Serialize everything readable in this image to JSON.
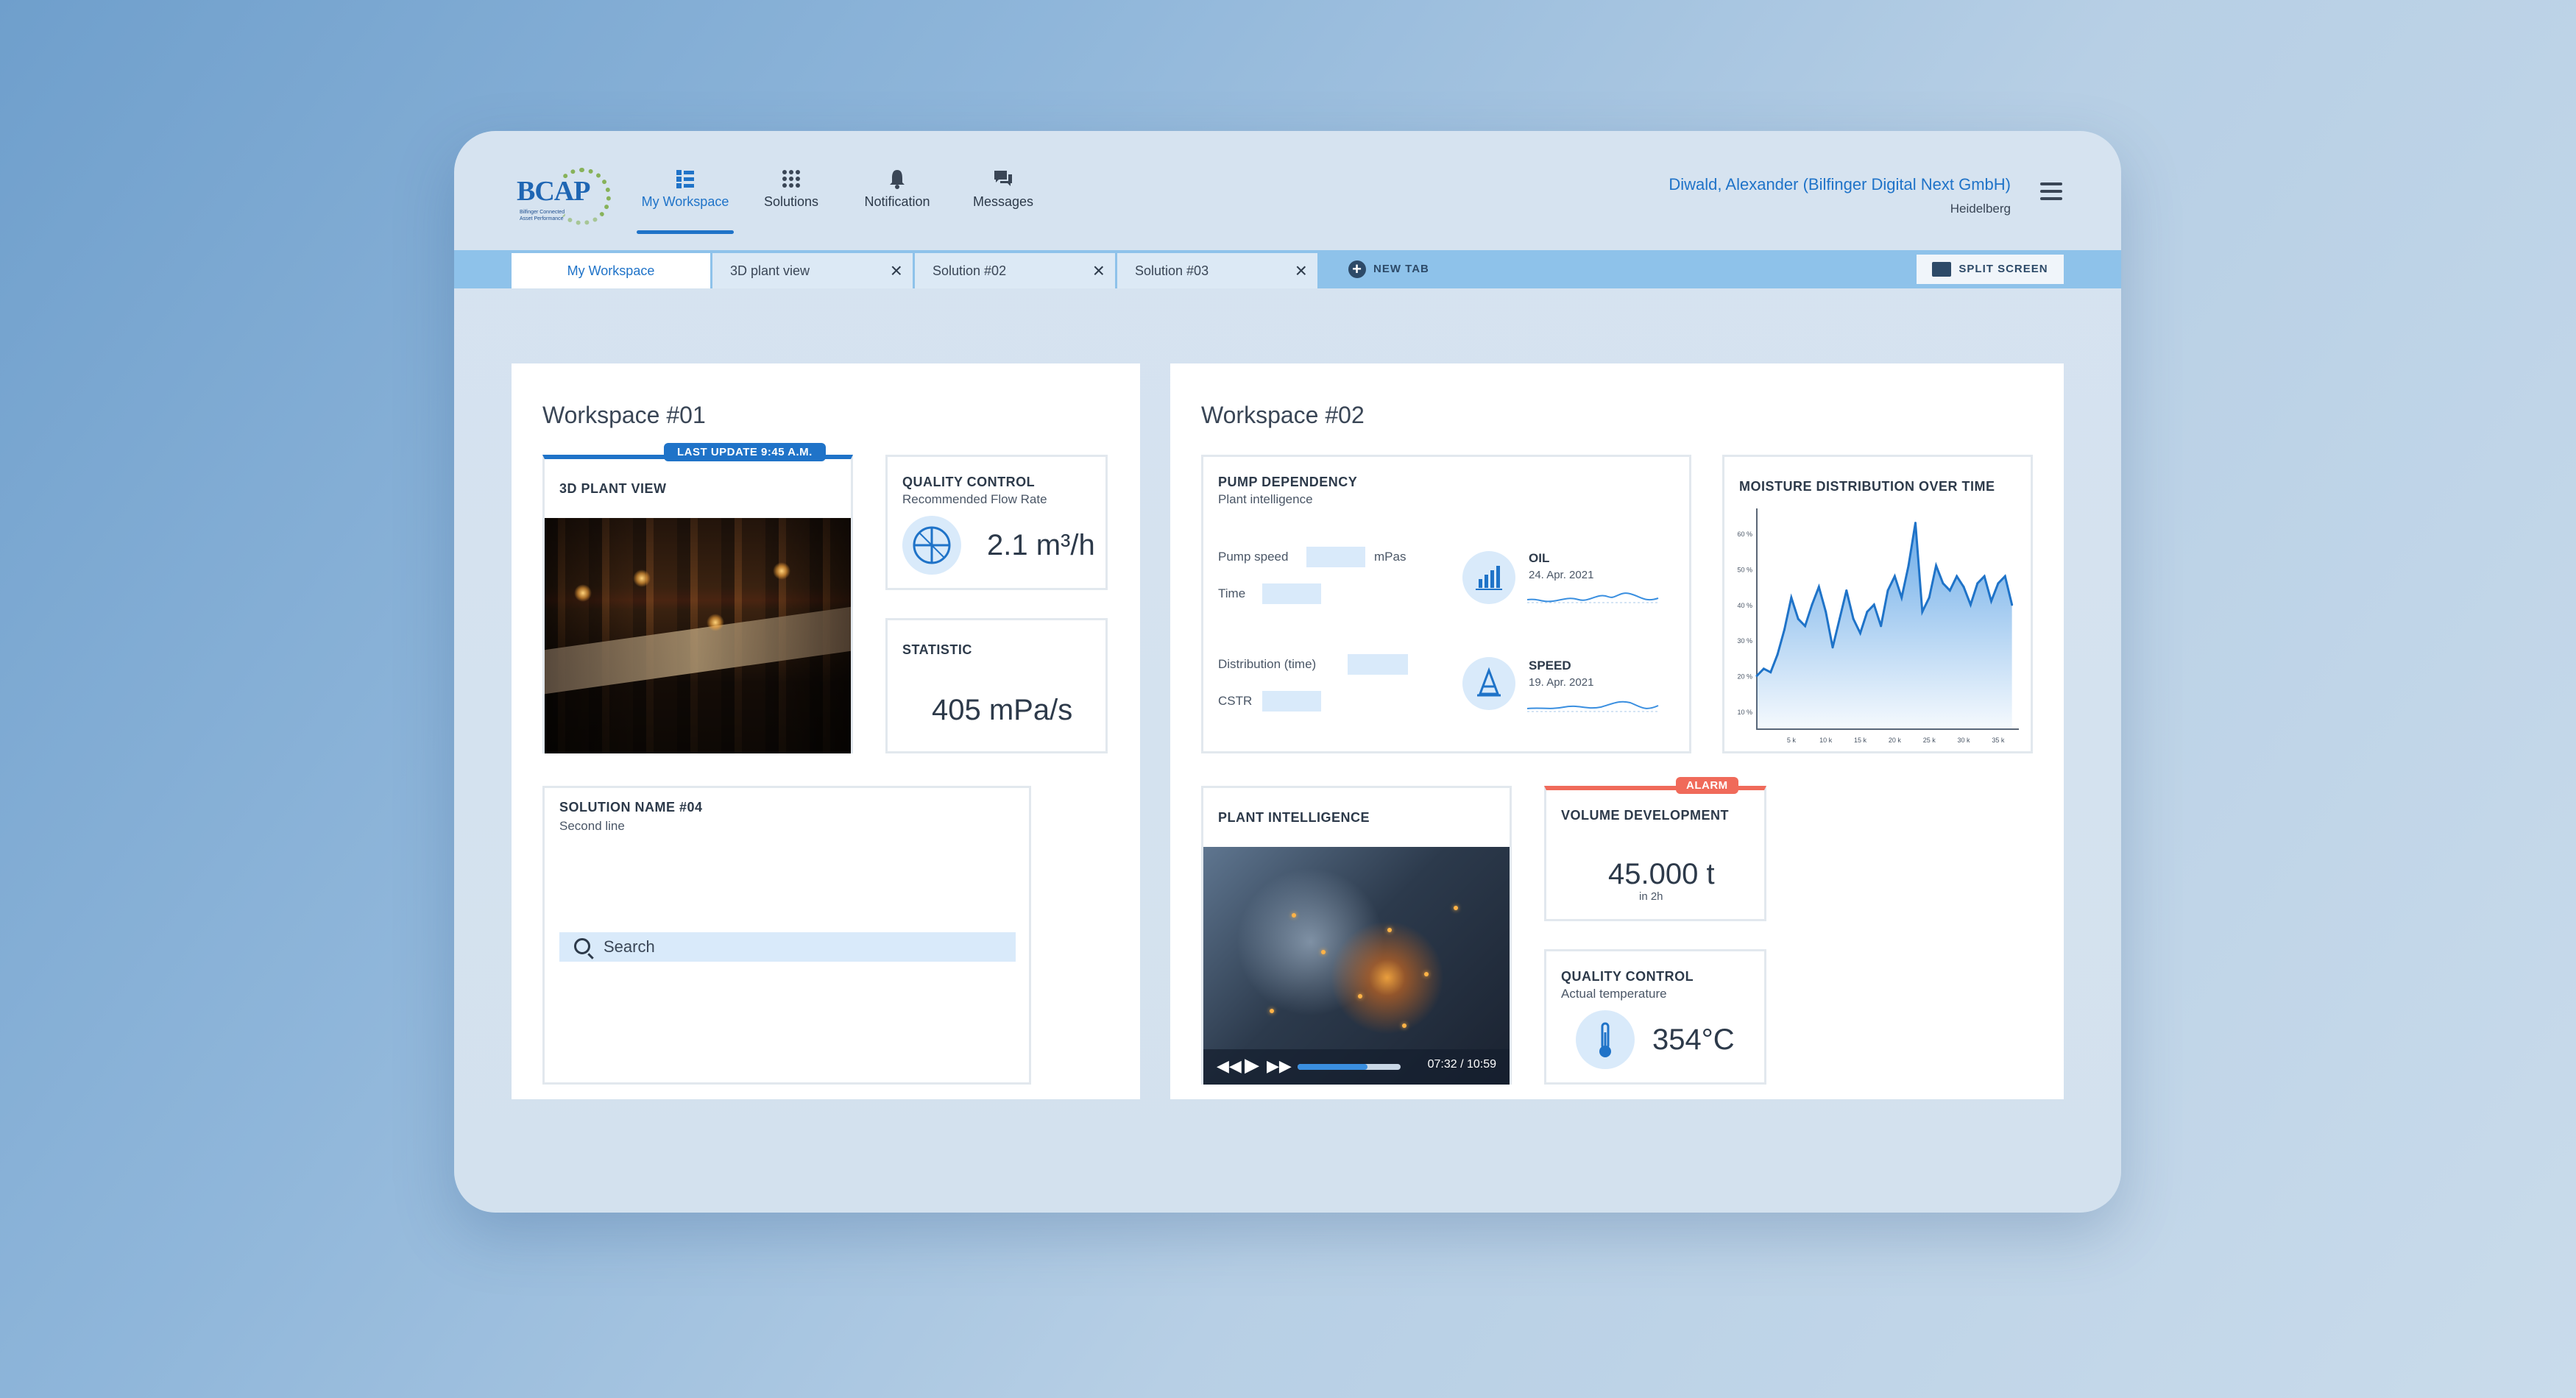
{
  "app": {
    "logo_text": "BCAP",
    "logo_sub": "Bilfinger Connected Asset Performance"
  },
  "nav": [
    {
      "label": "My Workspace",
      "icon": "workspace-icon",
      "active": true
    },
    {
      "label": "Solutions",
      "icon": "grid-icon",
      "active": false
    },
    {
      "label": "Notification",
      "icon": "bell-icon",
      "active": false
    },
    {
      "label": "Messages",
      "icon": "chat-icon",
      "active": false
    }
  ],
  "user": {
    "name": "Diwald, Alexander (Bilfinger Digital Next GmbH)",
    "location": "Heidelberg"
  },
  "tabs": [
    {
      "label": "My Workspace",
      "active": true,
      "closable": false
    },
    {
      "label": "3D plant view",
      "active": false,
      "closable": true
    },
    {
      "label": "Solution #02",
      "active": false,
      "closable": true
    },
    {
      "label": "Solution #03",
      "active": false,
      "closable": true
    }
  ],
  "new_tab_label": "NEW TAB",
  "split_screen_label": "SPLIT SCREEN",
  "ws1": {
    "title": "Workspace #01",
    "plant_view": {
      "title": "3D PLANT VIEW",
      "badge": "LAST UPDATE 9:45 A.M."
    },
    "quality": {
      "title": "QUALITY CONTROL",
      "sub": "Recommended Flow Rate",
      "value": "2.1 m³/h"
    },
    "statistic": {
      "title": "STATISTIC",
      "value": "405 mPa/s"
    },
    "solution": {
      "title": "SOLUTION NAME #04",
      "sub": "Second line",
      "search_placeholder": "Search"
    }
  },
  "ws2": {
    "title": "Workspace #02",
    "pump": {
      "title": "PUMP DEPENDENCY",
      "sub": "Plant intelligence",
      "pump_speed": "Pump speed",
      "unit": "mPas",
      "time": "Time",
      "distribution": "Distribution (time)",
      "cstr": "CSTR",
      "oil_title": "OIL",
      "oil_date": "24. Apr. 2021",
      "speed_title": "SPEED",
      "speed_date": "19. Apr. 2021"
    },
    "moisture": {
      "title": "MOISTURE DISTRIBUTION OVER TIME"
    },
    "plant_intel": {
      "title": "PLANT INTELLIGENCE",
      "time": "07:32 / 10:59",
      "progress": 0.68
    },
    "volume": {
      "title": "VOLUME DEVELOPMENT",
      "badge": "ALARM",
      "value": "45.000 t",
      "sub": "in 2h"
    },
    "quality2": {
      "title": "QUALITY CONTROL",
      "sub": "Actual temperature",
      "value": "354°C"
    }
  },
  "colors": {
    "accent": "#1f73c8",
    "alarm": "#f06a5a",
    "badge_blue": "#1f73c8"
  },
  "chart_data": {
    "type": "area",
    "title": "MOISTURE DISTRIBUTION OVER TIME",
    "x_ticks": [
      "5 k",
      "10 k",
      "15 k",
      "20 k",
      "25 k",
      "30 k",
      "35 k"
    ],
    "y_ticks": [
      "10 %",
      "20 %",
      "30 %",
      "40 %",
      "50 %",
      "60 %"
    ],
    "ylim": [
      5,
      65
    ],
    "xlim": [
      0,
      38
    ],
    "x": [
      0,
      1,
      2,
      3,
      4,
      5,
      6,
      7,
      8,
      9,
      10,
      11,
      12,
      13,
      14,
      15,
      16,
      17,
      18,
      19,
      20,
      21,
      22,
      23,
      24,
      25,
      26,
      27,
      28,
      29,
      30,
      31,
      32,
      33,
      34,
      35,
      36,
      37
    ],
    "values": [
      20,
      22,
      21,
      26,
      33,
      42,
      36,
      34,
      40,
      45,
      38,
      28,
      36,
      44,
      36,
      32,
      38,
      40,
      34,
      44,
      48,
      42,
      51,
      63,
      38,
      42,
      51,
      46,
      44,
      48,
      45,
      40,
      46,
      48,
      41,
      46,
      48,
      40
    ]
  }
}
